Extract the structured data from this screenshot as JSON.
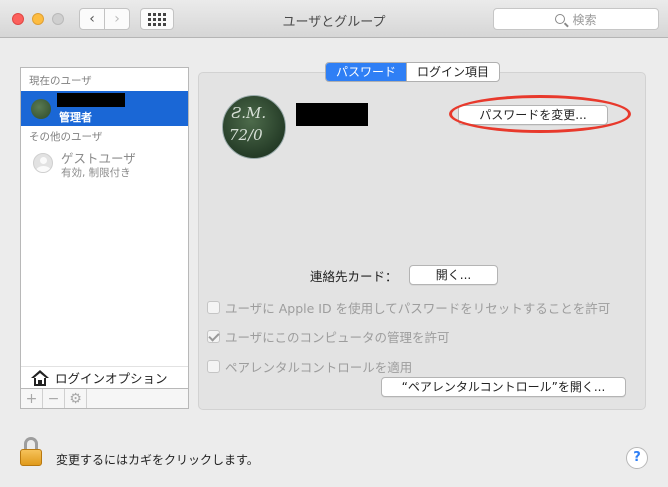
{
  "window": {
    "title": "ユーザとグループ"
  },
  "toolbar": {
    "back": "‹",
    "forward": "›",
    "search_placeholder": "検索"
  },
  "sidebar": {
    "current_users_header": "現在のユーザ",
    "current_user": {
      "role": "管理者"
    },
    "other_users_header": "その他のユーザ",
    "guest": {
      "name": "ゲストユーザ",
      "status": "有効, 制限付き"
    },
    "login_options": "ログインオプション",
    "tools": {
      "add": "+",
      "remove": "−",
      "action": "⚙"
    }
  },
  "tabs": [
    {
      "label": "パスワード",
      "active": true
    },
    {
      "label": "ログイン項目",
      "active": false
    }
  ],
  "main": {
    "change_password_button": "パスワードを変更...",
    "contact_card_label": "連絡先カード：",
    "open_button": "開く...",
    "checkbox_apple_id": {
      "label": "ユーザに Apple ID を使用してパスワードをリセットすることを許可",
      "checked": false,
      "enabled": false
    },
    "checkbox_admin": {
      "label": "ユーザにこのコンピュータの管理を許可",
      "checked": true,
      "enabled": false
    },
    "checkbox_parental": {
      "label": "ペアレンタルコントロールを適用",
      "checked": false,
      "enabled": false
    },
    "open_parental_button": "“ペアレンタルコントロール”を開く...",
    "avatar_chalk": [
      "Ƨ.M.",
      "72/0"
    ]
  },
  "footer": {
    "lock_text": "変更するにはカギをクリックします。",
    "help": "?"
  },
  "colors": {
    "selection": "#1a67d6",
    "active_tab": "#2f7ff5",
    "annotation_circle": "#e8392c"
  }
}
